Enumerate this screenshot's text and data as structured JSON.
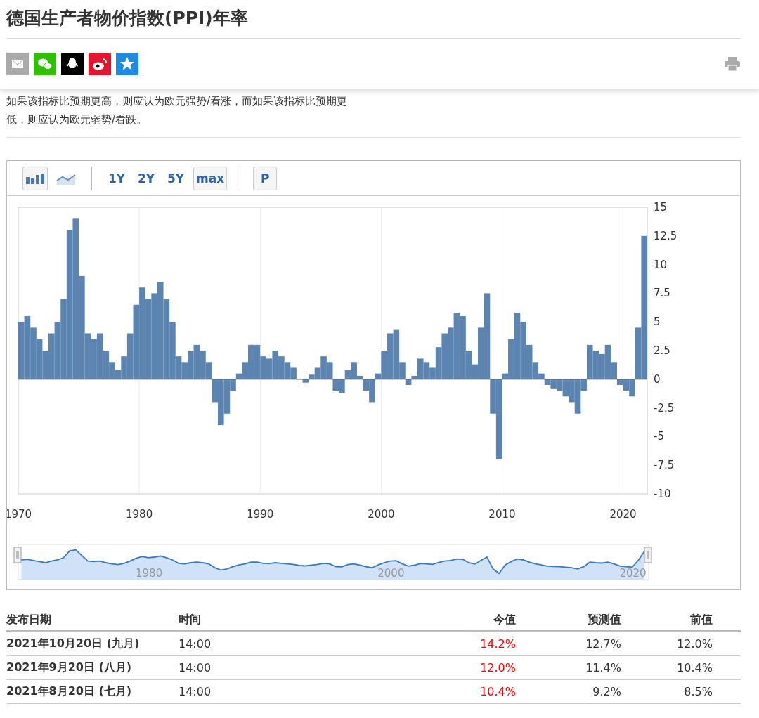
{
  "title": "德国生产者物价指数(PPI)年率",
  "description": [
    "如果该指标比预期更高，则应认为欧元强势/看涨，而如果该指标比预期更",
    "低，则应认为欧元弱势/看跌。"
  ],
  "toolbar": {
    "chart_types": [
      {
        "kind": "bar",
        "selected": true
      },
      {
        "kind": "line",
        "selected": false
      }
    ],
    "ranges": [
      {
        "label": "1Y",
        "selected": false
      },
      {
        "label": "2Y",
        "selected": false
      },
      {
        "label": "5Y",
        "selected": false
      },
      {
        "label": "max",
        "selected": true
      }
    ],
    "extra_button": "P"
  },
  "chart": {
    "chart_data": {
      "type": "bar",
      "xlim": [
        1970,
        2022
      ],
      "ylim": [
        -10,
        15
      ],
      "xticks": [
        1970,
        1980,
        1990,
        2000,
        2010,
        2020
      ],
      "yticks": [
        {
          "value": -10,
          "label": "-10"
        },
        {
          "value": -7.5,
          "label": "-7.5"
        },
        {
          "value": -5,
          "label": "-5"
        },
        {
          "value": -2.5,
          "label": "-2.5"
        },
        {
          "value": 0,
          "label": "0"
        },
        {
          "value": 2.5,
          "label": "2.5"
        },
        {
          "value": 5,
          "label": "5"
        },
        {
          "value": 7.5,
          "label": "7.5"
        },
        {
          "value": 10,
          "label": "10"
        },
        {
          "value": 12.5,
          "label": "12.5"
        },
        {
          "value": 15,
          "label": "15"
        }
      ],
      "x": [
        1970,
        1970.5,
        1971,
        1971.5,
        1972,
        1972.5,
        1973,
        1973.5,
        1974,
        1974.5,
        1975,
        1975.5,
        1976,
        1976.5,
        1977,
        1977.5,
        1978,
        1978.5,
        1979,
        1979.5,
        1980,
        1980.5,
        1981,
        1981.5,
        1982,
        1982.5,
        1983,
        1983.5,
        1984,
        1984.5,
        1985,
        1985.5,
        1986,
        1986.5,
        1987,
        1987.5,
        1988,
        1988.5,
        1989,
        1989.5,
        1990,
        1990.5,
        1991,
        1991.5,
        1992,
        1992.5,
        1993,
        1993.5,
        1994,
        1994.5,
        1995,
        1995.5,
        1996,
        1996.5,
        1997,
        1997.5,
        1998,
        1998.5,
        1999,
        1999.5,
        2000,
        2000.5,
        2001,
        2001.5,
        2002,
        2002.5,
        2003,
        2003.5,
        2004,
        2004.5,
        2005,
        2005.5,
        2006,
        2006.5,
        2007,
        2007.5,
        2008,
        2008.5,
        2009,
        2009.5,
        2010,
        2010.5,
        2011,
        2011.5,
        2012,
        2012.5,
        2013,
        2013.5,
        2014,
        2014.5,
        2015,
        2015.5,
        2016,
        2016.5,
        2017,
        2017.5,
        2018,
        2018.5,
        2019,
        2019.5,
        2020,
        2020.5,
        2021,
        2021.5
      ],
      "grid": true,
      "series": [
        {
          "color": "#5b84b1",
          "values": [
            5,
            5.5,
            4.5,
            3.5,
            2.5,
            4,
            5,
            7,
            13,
            14,
            9,
            4,
            3.5,
            4,
            2.5,
            1.5,
            0.8,
            2,
            4,
            6.5,
            8,
            7,
            7.5,
            8.5,
            7,
            5,
            2,
            1.5,
            2.5,
            3,
            2.5,
            1.5,
            -2,
            -4,
            -3,
            -1,
            0.5,
            1.5,
            3,
            3,
            2,
            1.8,
            2.5,
            2,
            1.5,
            1,
            0,
            -0.3,
            0.4,
            1,
            2,
            1.5,
            -1,
            -1.2,
            0.8,
            1.5,
            0.3,
            -1,
            -2,
            0.5,
            2.5,
            4,
            4.3,
            1.5,
            -0.5,
            0.3,
            1.8,
            1.5,
            1,
            2.8,
            4,
            4.5,
            5.8,
            5.5,
            2.5,
            1.3,
            4.5,
            7.5,
            -3,
            -7,
            0.5,
            3.5,
            5.8,
            5,
            3,
            1.5,
            0.5,
            -0.5,
            -0.8,
            -1,
            -1.5,
            -2,
            -3,
            -1,
            3,
            2.5,
            2.2,
            3,
            1.5,
            -0.5,
            -1,
            -1.5,
            4.5,
            12.5
          ]
        }
      ]
    }
  },
  "navigator": {
    "labels": [
      "1980",
      "2000",
      "2020"
    ]
  },
  "table": {
    "columns": [
      {
        "label": "发布日期"
      },
      {
        "label": "时间"
      },
      {
        "label": "今值",
        "color": "#ff0000"
      },
      {
        "label": "预测值"
      },
      {
        "label": "前值"
      }
    ],
    "rows": [
      [
        "2021年10月20日 (九月)",
        "14:00",
        "14.2%",
        "12.7%",
        "12.0%"
      ],
      [
        "2021年9月20日 (八月)",
        "14:00",
        "12.0%",
        "11.4%",
        "10.4%"
      ],
      [
        "2021年8月20日 (七月)",
        "14:00",
        "10.4%",
        "9.2%",
        "8.5%"
      ]
    ]
  }
}
